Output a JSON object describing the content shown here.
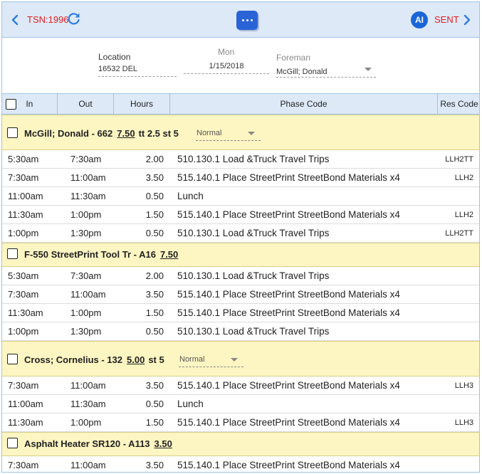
{
  "topbar": {
    "tsn": "TSN:1996",
    "ai_label": "AI",
    "sent": "SENT"
  },
  "header": {
    "location_label": "Location",
    "location_value": "16532 DEL",
    "day_label": "Mon",
    "date_value": "1/15/2018",
    "foreman_label": "Foreman",
    "foreman_value": "McGill; Donald"
  },
  "columns": {
    "in": "In",
    "out": "Out",
    "hours": "Hours",
    "phase": "Phase Code",
    "res": "Res Code"
  },
  "groups": [
    {
      "title": "McGill; Donald - 662",
      "hours": "7.50",
      "extra": "tt 2.5 st 5",
      "select": "Normal",
      "rows": [
        {
          "in": "5:30am",
          "out": "7:30am",
          "hours": "2.00",
          "phase": "510.130.1 Load &Truck Travel Trips",
          "res": "LLH2TT"
        },
        {
          "in": "7:30am",
          "out": "11:00am",
          "hours": "3.50",
          "phase": "515.140.1 Place StreetPrint StreetBond Materials x4",
          "res": "LLH2"
        },
        {
          "in": "11:00am",
          "out": "11:30am",
          "hours": "0.50",
          "phase": "Lunch",
          "res": ""
        },
        {
          "in": "11:30am",
          "out": "1:00pm",
          "hours": "1.50",
          "phase": "515.140.1 Place StreetPrint StreetBond Materials x4",
          "res": "LLH2"
        },
        {
          "in": "1:00pm",
          "out": "1:30pm",
          "hours": "0.50",
          "phase": "510.130.1 Load &Truck Travel Trips",
          "res": "LLH2TT"
        }
      ]
    },
    {
      "title": "F-550 StreetPrint Tool Tr - A16",
      "hours": "7.50",
      "extra": "",
      "select": "",
      "rows": [
        {
          "in": "5:30am",
          "out": "7:30am",
          "hours": "2.00",
          "phase": "510.130.1 Load &Truck Travel Trips",
          "res": ""
        },
        {
          "in": "7:30am",
          "out": "11:00am",
          "hours": "3.50",
          "phase": "515.140.1 Place StreetPrint StreetBond Materials x4",
          "res": ""
        },
        {
          "in": "11:30am",
          "out": "1:00pm",
          "hours": "1.50",
          "phase": "515.140.1 Place StreetPrint StreetBond Materials x4",
          "res": ""
        },
        {
          "in": "1:00pm",
          "out": "1:30pm",
          "hours": "0.50",
          "phase": "510.130.1 Load &Truck Travel Trips",
          "res": ""
        }
      ]
    },
    {
      "title": "Cross; Cornelius - 132",
      "hours": "5.00",
      "extra": "st 5",
      "select": "Normal",
      "rows": [
        {
          "in": "7:30am",
          "out": "11:00am",
          "hours": "3.50",
          "phase": "515.140.1 Place StreetPrint StreetBond Materials x4",
          "res": "LLH3"
        },
        {
          "in": "11:00am",
          "out": "11:30am",
          "hours": "0.50",
          "phase": "Lunch",
          "res": ""
        },
        {
          "in": "11:30am",
          "out": "1:00pm",
          "hours": "1.50",
          "phase": "515.140.1 Place StreetPrint StreetBond Materials x4",
          "res": "LLH3"
        }
      ]
    },
    {
      "title": "Asphalt Heater SR120 - A113",
      "hours": "3.50",
      "extra": "",
      "select": "",
      "rows": [
        {
          "in": "7:30am",
          "out": "11:00am",
          "hours": "3.50",
          "phase": "515.140.1 Place StreetPrint StreetBond Materials x4",
          "res": ""
        }
      ]
    }
  ]
}
